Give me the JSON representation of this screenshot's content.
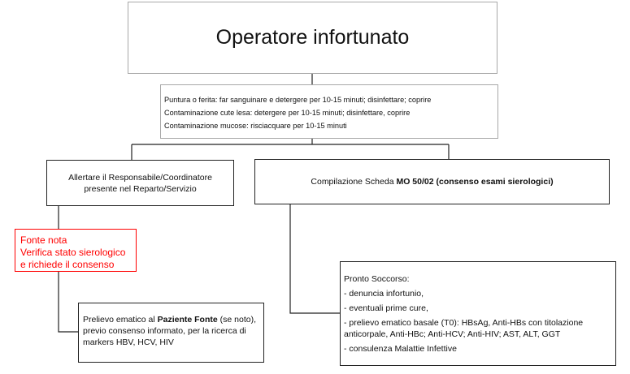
{
  "title": "Operatore infortunato",
  "first_aid": [
    "Puntura o ferita: far sanguinare e detergere per 10-15 minuti; disinfettare; coprire",
    "Contaminazione cute lesa: detergere per 10-15 minuti; disinfettare, coprire",
    "Contaminazione mucose: risciacquare per 10-15 minuti"
  ],
  "alert": {
    "line1": "Allertare il Responsabile/Coordinatore",
    "line2": "presente nel Reparto/Servizio"
  },
  "form": {
    "prefix": "Compilazione Scheda ",
    "bold": "MO 50/02 (consenso esami sierologici)"
  },
  "source": {
    "lines": [
      "Fonte nota",
      "Verifica stato sierologico",
      "e richiede il consenso"
    ],
    "color": "#ff0000"
  },
  "blood_test": {
    "prefix": "Prelievo ematico al ",
    "bold": "Paziente Fonte",
    "suffix": " (se noto), previo consenso informato, per la ricerca di markers HBV, HCV, HIV"
  },
  "emergency": {
    "heading": "Pronto Soccorso:",
    "items": [
      "- denuncia infortunio,",
      "- eventuali prime cure,",
      "- prelievo ematico basale (T0): HBsAg, Anti-HBs con titolazione anticorpale, Anti-HBc; Anti-HCV; Anti-HIV; AST, ALT, GGT",
      "- consulenza Malattie Infettive"
    ]
  },
  "colors": {
    "connector": "#222222",
    "light_border": "#a8a8a8",
    "dark_border": "#222222",
    "highlight": "#ff0000"
  }
}
